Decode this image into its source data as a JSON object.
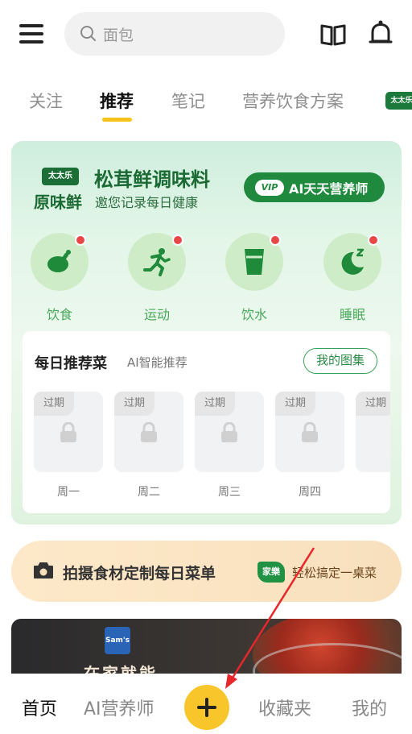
{
  "search": {
    "placeholder": "面包",
    "icon": "search-icon"
  },
  "tabs": [
    {
      "label": "关注",
      "active": false
    },
    {
      "label": "推荐",
      "active": true
    },
    {
      "label": "笔记",
      "active": false
    },
    {
      "label": "营养饮食方案",
      "active": false
    }
  ],
  "tab_logo": {
    "text": "太太乐"
  },
  "health_card": {
    "brand_logo": "太太乐",
    "brand_name": "原味鲜",
    "title": "松茸鲜调味料",
    "subtitle": "邀您记录每日健康",
    "vip_badge": "VIP",
    "vip_label": "AI天天营养师",
    "categories": [
      {
        "label": "饮食",
        "icon": "chicken-icon"
      },
      {
        "label": "运动",
        "icon": "running-icon"
      },
      {
        "label": "饮水",
        "icon": "water-cup-icon"
      },
      {
        "label": "睡眠",
        "icon": "moon-sleep-icon"
      }
    ],
    "daily": {
      "title": "每日推荐菜",
      "subtitle": "AI智能推荐",
      "gallery_button": "我的图集",
      "expired_label": "过期",
      "days": [
        "周一",
        "周二",
        "周三",
        "周四"
      ]
    }
  },
  "capture_banner": {
    "title": "拍摄食材定制每日菜单",
    "logo": "家樂",
    "subtitle": "轻松搞定一桌菜"
  },
  "promo": {
    "logo": "Sam's",
    "text": "在家就能"
  },
  "bottom_nav": {
    "items": [
      {
        "label": "首页",
        "active": true
      },
      {
        "label": "AI营养师",
        "active": false
      },
      {
        "label": "收藏夹",
        "active": false
      },
      {
        "label": "我的",
        "active": false
      }
    ]
  },
  "colors": {
    "accent_yellow": "#f8c52a",
    "brand_green": "#1f8a3d",
    "badge_red": "#e94747"
  }
}
